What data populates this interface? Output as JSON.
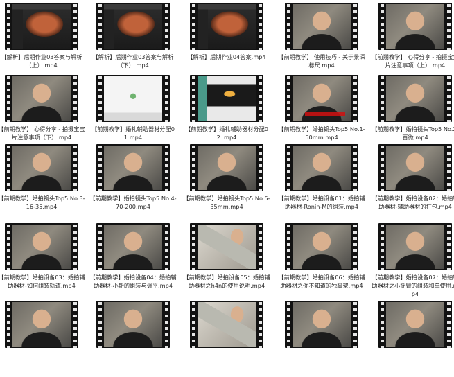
{
  "items": [
    {
      "label": "【解析】后期作业03答案与解析（上）.mp4",
      "thumb": "editor"
    },
    {
      "label": "【解析】后期作业03答案与解析（下）.mp4",
      "thumb": "editor"
    },
    {
      "label": "【解析】后期作业04答案.mp4",
      "thumb": "editor"
    },
    {
      "label": "【前期教学】 使用技巧 - 关于景深标尺.mp4",
      "thumb": "video"
    },
    {
      "label": "【前期教学】 心得分享 - 拍摄宝宝片注意事项（上）.mp4",
      "thumb": "video"
    },
    {
      "label": "【前期教学】 心得分享 - 拍摄宝宝片注意事项（下）.mp4",
      "thumb": "video"
    },
    {
      "label": "【前期教学】婚礼辅助器材分配01.mp4",
      "thumb": "screen"
    },
    {
      "label": "【前期教学】婚礼辅助器材分配02..mp4",
      "thumb": "screen2"
    },
    {
      "label": "【前期教学】婚拍镜头Top5 No.1-50mm.mp4",
      "thumb": "video",
      "overlay": true
    },
    {
      "label": "【前期教学】婚拍镜头Top5 No.2-百微.mp4",
      "thumb": "video"
    },
    {
      "label": "【前期教学】婚拍镜头Top5 No.3-16-35.mp4",
      "thumb": "video"
    },
    {
      "label": "【前期教学】婚拍镜头Top5 No.4-70-200.mp4",
      "thumb": "video"
    },
    {
      "label": "【前期教学】婚拍镜头Top5 No.5-35mm.mp4",
      "thumb": "video"
    },
    {
      "label": "【前期教学】婚拍设备01：婚拍辅助器材-Ronin-M的组装.mp4",
      "thumb": "video"
    },
    {
      "label": "【前期教学】婚拍设备02：婚拍辅助器材-辅助器材的打包.mp4",
      "thumb": "video"
    },
    {
      "label": "【前期教学】婚拍设备03：婚拍辅助器材-如何组装轨道.mp4",
      "thumb": "video"
    },
    {
      "label": "【前期教学】婚拍设备04：婚拍辅助器材-小斯的组装与调平.mp4",
      "thumb": "video"
    },
    {
      "label": "【前期教学】婚拍设备05：婚拍辅助器材之h4n的使用说明.mp4",
      "thumb": "device"
    },
    {
      "label": "【前期教学】婚拍设备06：婚拍辅助器材之你不知道的独脚架.mp4",
      "thumb": "video"
    },
    {
      "label": "【前期教学】婚拍设备07：婚拍辅助器材之小摇臂的组装和单使用.mp4",
      "thumb": "video"
    },
    {
      "label": "",
      "thumb": "video"
    },
    {
      "label": "",
      "thumb": "video"
    },
    {
      "label": "",
      "thumb": "device"
    },
    {
      "label": "",
      "thumb": "video"
    },
    {
      "label": "",
      "thumb": "video"
    }
  ]
}
